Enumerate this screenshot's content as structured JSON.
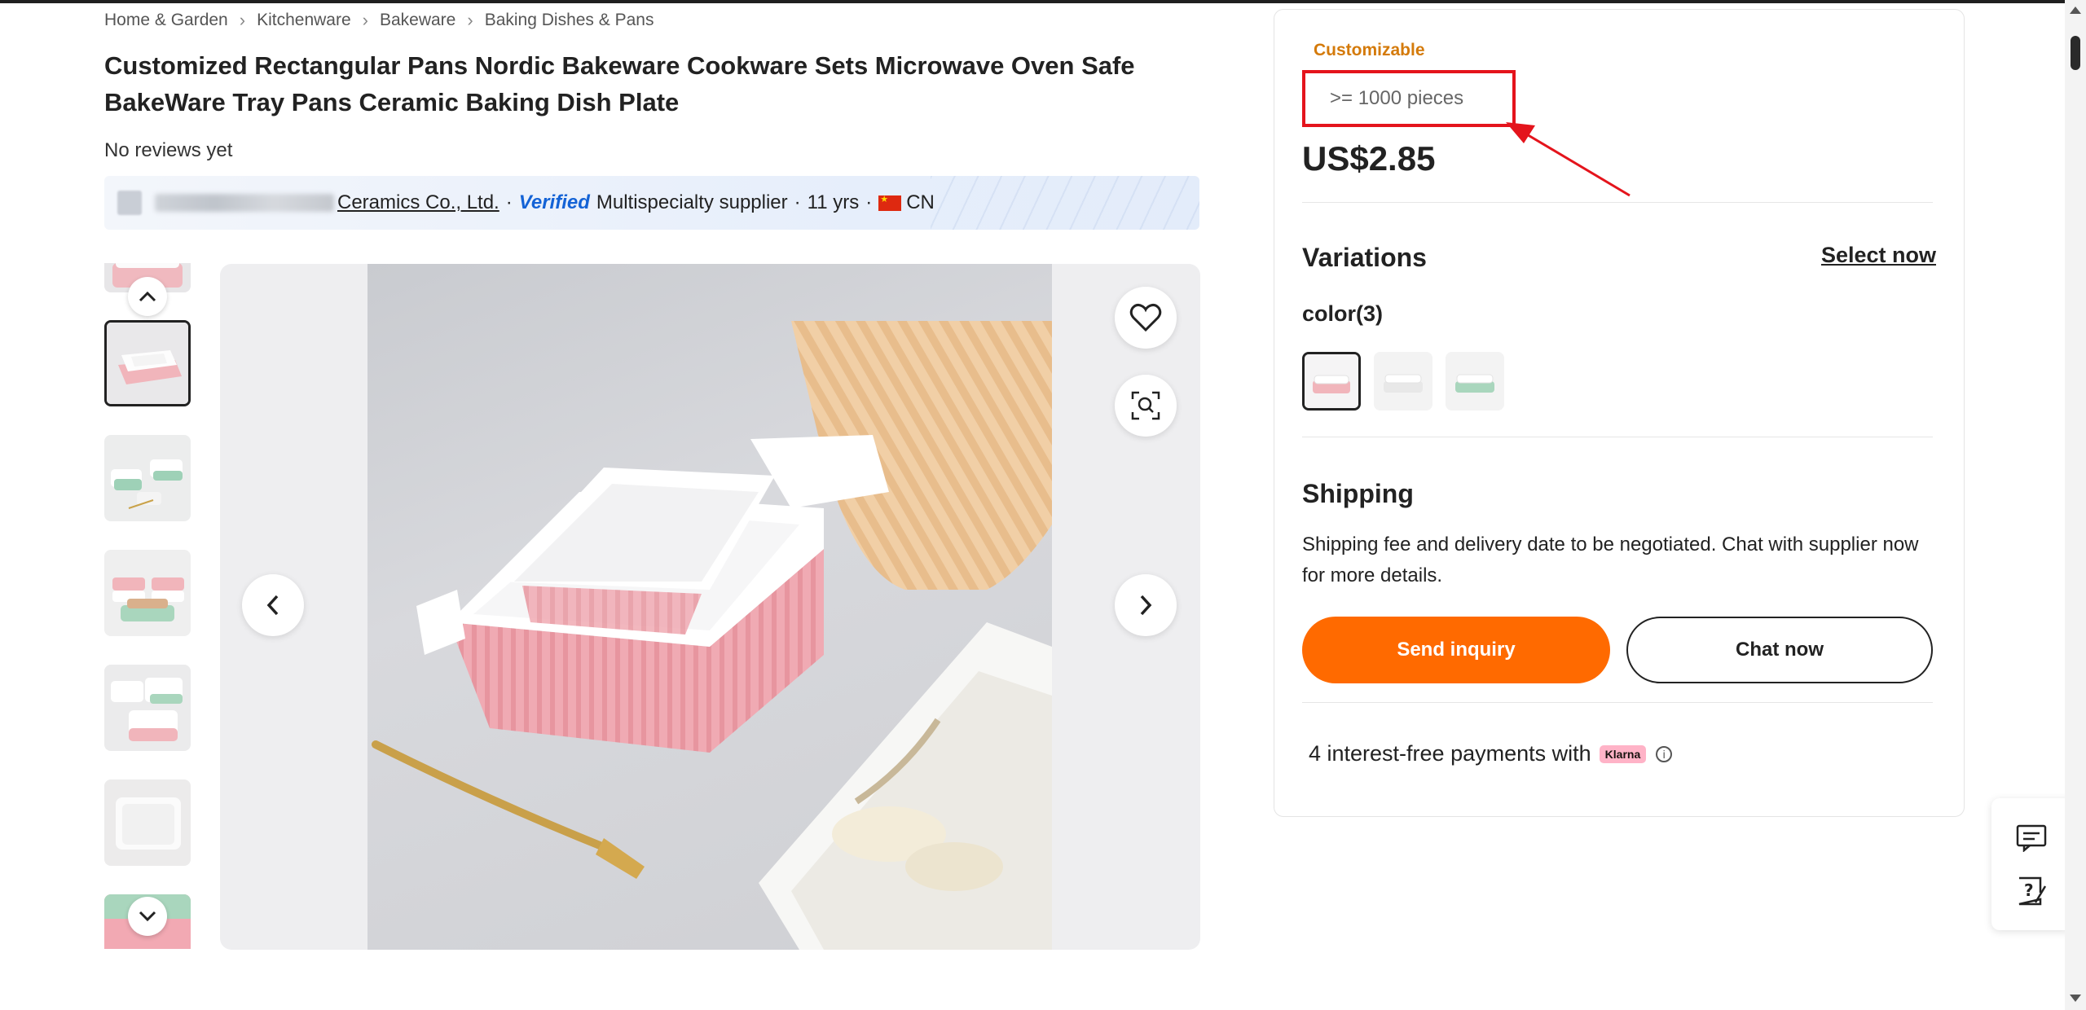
{
  "breadcrumb": [
    "Home & Garden",
    "Kitchenware",
    "Bakeware",
    "Baking Dishes & Pans"
  ],
  "product": {
    "title": "Customized Rectangular Pans Nordic Bakeware Cookware Sets Microwave Oven Safe BakeWare Tray Pans Ceramic Baking Dish Plate",
    "reviews": "No reviews yet"
  },
  "supplier": {
    "name": "Ceramics Co., Ltd.",
    "verified_label": "Verified",
    "type": "Multispecialty supplier",
    "years": "11 yrs",
    "country": "CN"
  },
  "panel": {
    "badge": "Customizable",
    "moq": ">= 1000 pieces",
    "price": "US$2.85",
    "variations_title": "Variations",
    "select_now": "Select now",
    "color_label": "color(3)",
    "shipping_title": "Shipping",
    "shipping_text": "Shipping fee and delivery date to be negotiated. Chat with supplier now for more details.",
    "send_inquiry": "Send inquiry",
    "chat_now": "Chat now",
    "payments_text": "4 interest-free payments with",
    "klarna": "Klarna"
  },
  "colors": {
    "accent_orange": "#ff6a00",
    "badge_orange": "#d47a0a",
    "annotation_red": "#e4141c",
    "verified_blue": "#1463d6",
    "dish_pink": "#f2b6bd"
  },
  "icons": [
    "chevron-right-icon",
    "chevron-up-icon",
    "chevron-down-icon",
    "chevron-left-icon",
    "heart-icon",
    "image-search-icon",
    "info-icon",
    "message-icon",
    "help-icon",
    "flag-cn-icon"
  ]
}
